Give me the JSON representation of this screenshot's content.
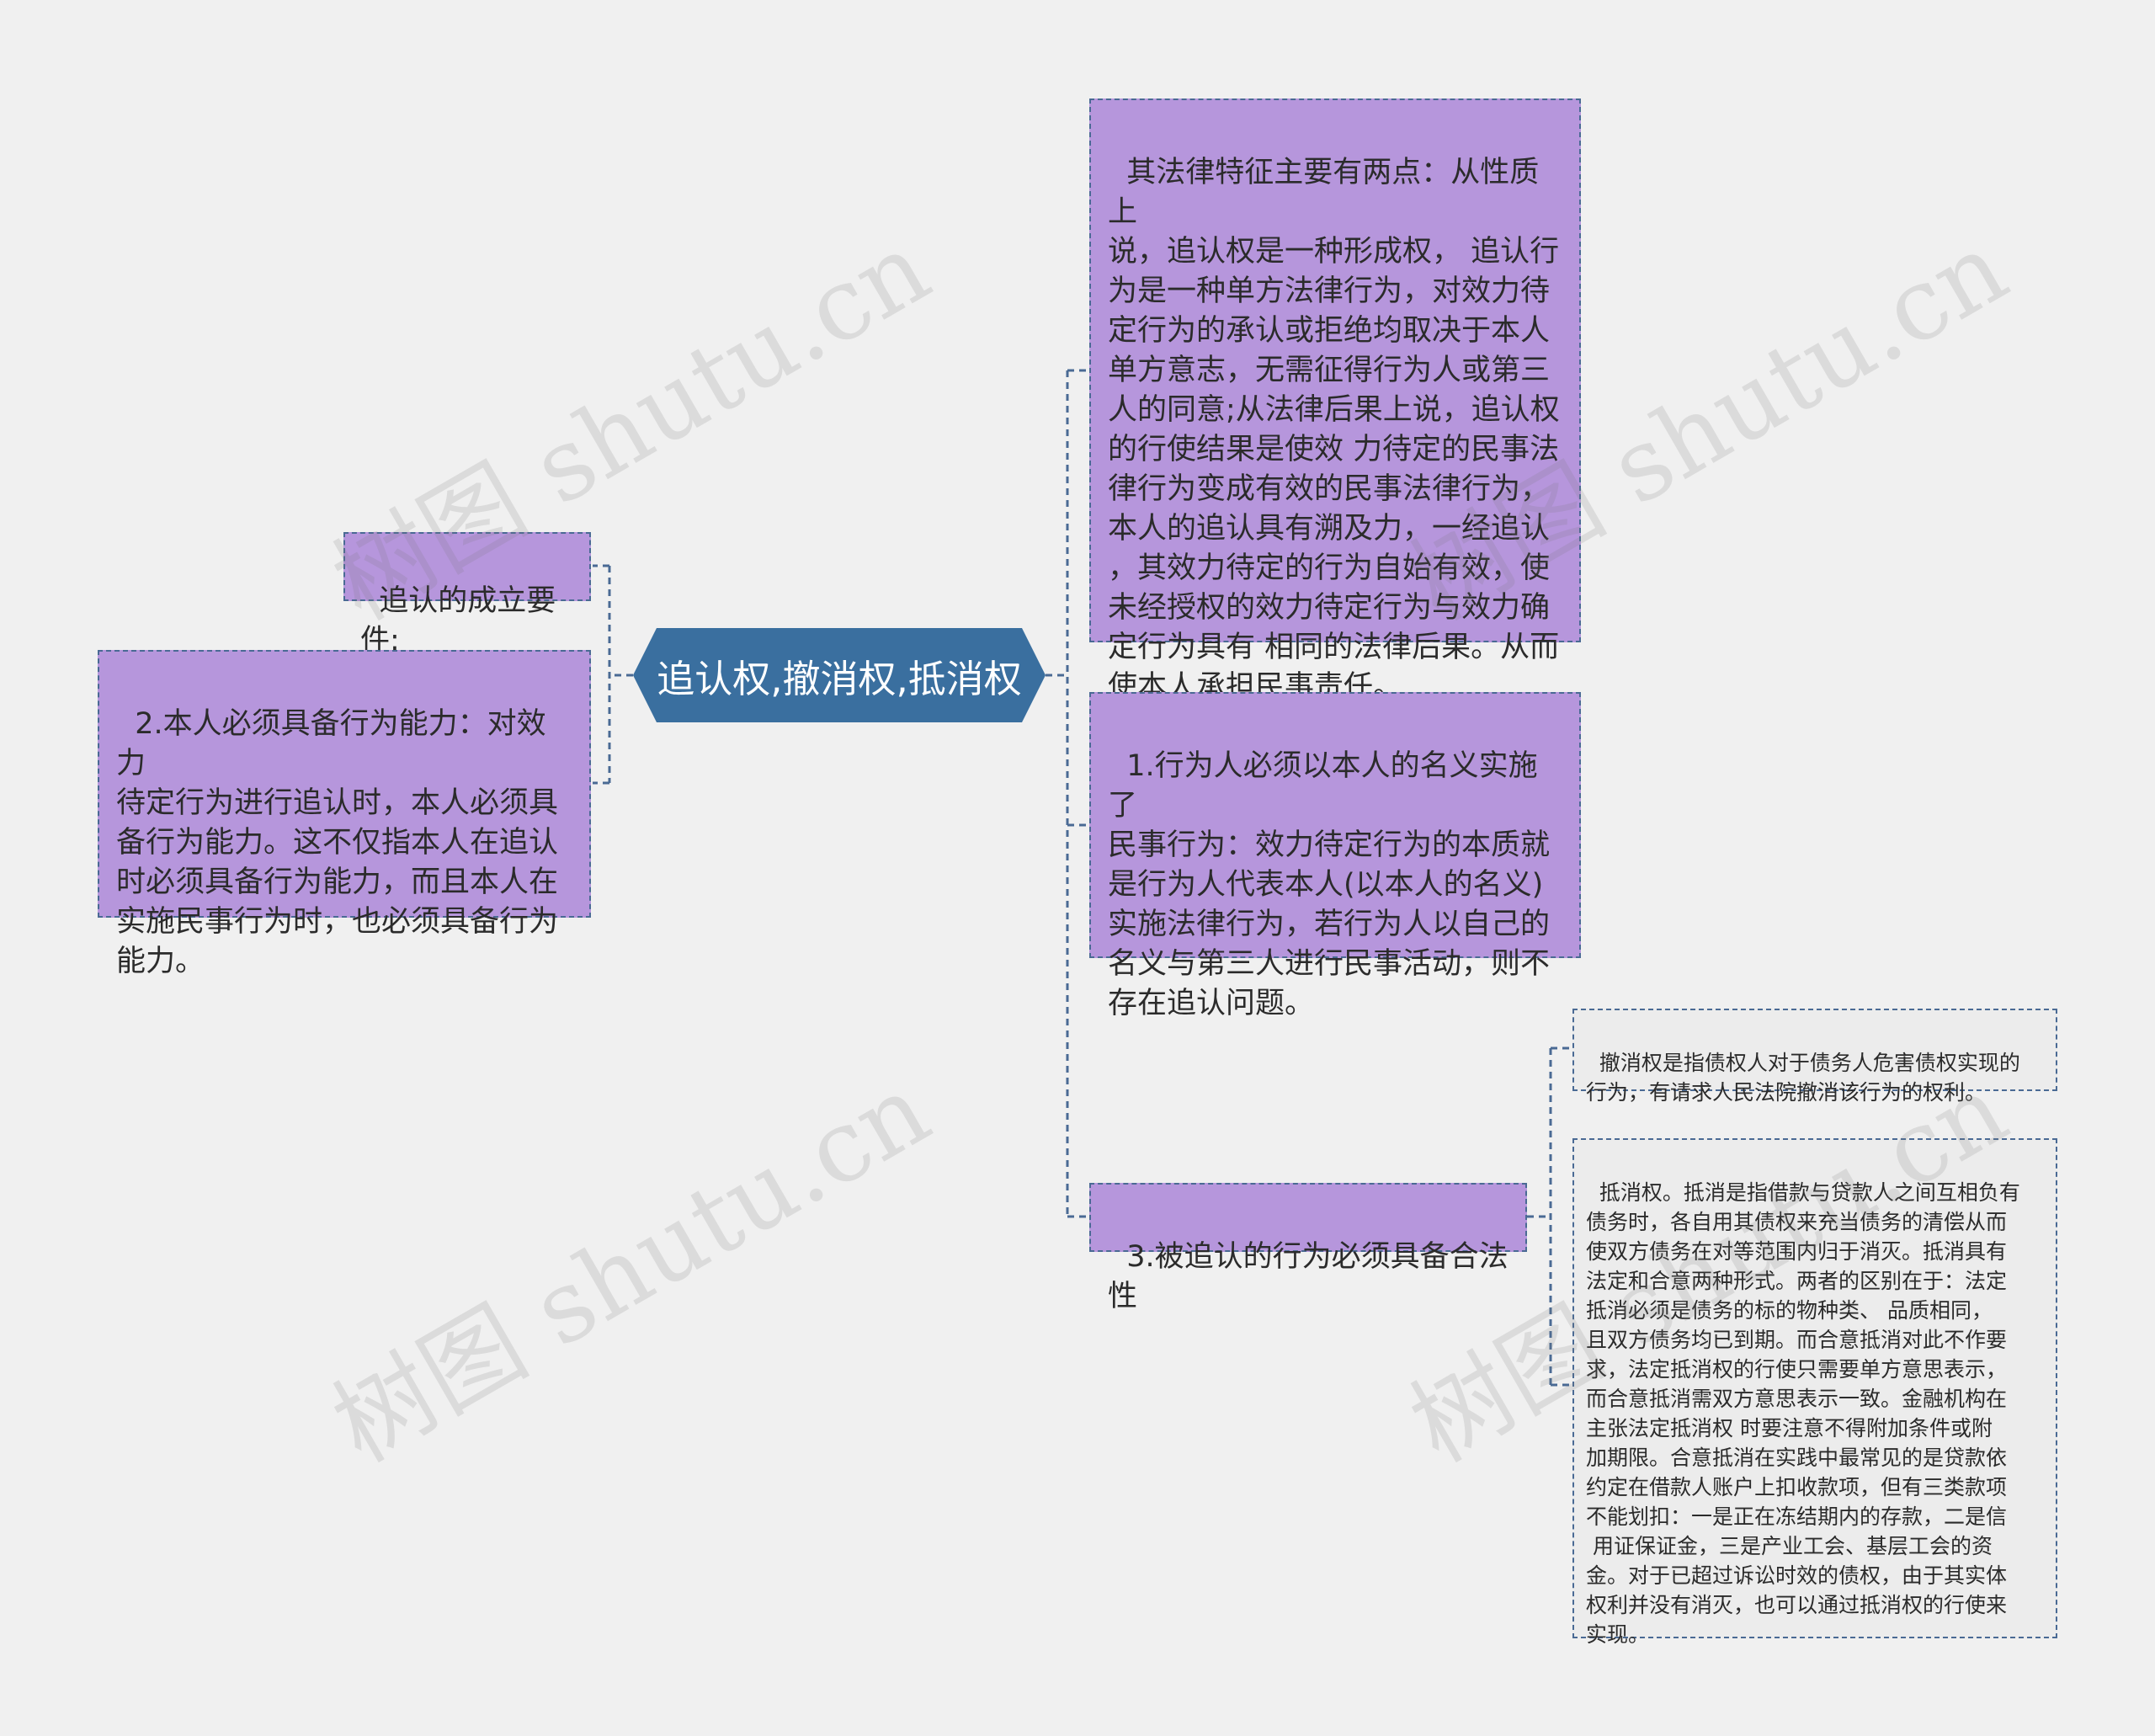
{
  "root": {
    "label": "追认权,撤消权,抵消权"
  },
  "left_branches": [
    {
      "text": "追认的成立要件:"
    },
    {
      "text": "2.本人必须具备行为能力：对效力\n待定行为进行追认时，本人必须具\n备行为能力。这不仅指本人在追认\n时必须具备行为能力，而且本人在\n实施民事行为时，也必须具备行为\n能力。"
    }
  ],
  "right_branches": [
    {
      "text": "其法律特征主要有两点：从性质上\n说，追认权是一种形成权， 追认行\n为是一种单方法律行为，对效力待\n定行为的承认或拒绝均取决于本人\n单方意志，无需征得行为人或第三\n人的同意;从法律后果上说，追认权\n的行使结果是使效 力待定的民事法\n律行为变成有效的民事法律行为，\n本人的追认具有溯及力，一经追认\n，其效力待定的行为自始有效，使\n未经授权的效力待定行为与效力确\n定行为具有 相同的法律后果。从而\n使本人承担民事责任。"
    },
    {
      "text": "1.行为人必须以本人的名义实施了\n民事行为：效力待定行为的本质就\n是行为人代表本人(以本人的名义)\n实施法律行为，若行为人以自己的\n名义与第三人进行民事活动，则不\n存在追认问题。"
    },
    {
      "text": "3.被追认的行为必须具备合法性",
      "children": [
        {
          "text": "撤消权是指债权人对于债务人危害债权实现的\n行为，有请求人民法院撤消该行为的权利。"
        },
        {
          "text": "抵消权。抵消是指借款与贷款人之间互相负有\n债务时，各自用其债权来充当债务的清偿从而\n使双方债务在对等范围内归于消灭。抵消具有\n法定和合意两种形式。两者的区别在于：法定\n抵消必须是债务的标的物种类、 品质相同，\n且双方债务均已到期。而合意抵消对此不作要\n求，法定抵消权的行使只需要单方意思表示，\n而合意抵消需双方意思表示一致。金融机构在\n主张法定抵消权 时要注意不得附加条件或附\n加期限。合意抵消在实践中最常见的是贷款依\n约定在借款人账户上扣收款项，但有三类款项\n不能划扣：一是正在冻结期内的存款，二是信\n 用证保证金，三是产业工会、基层工会的资\n金。对于已超过诉讼时效的债权，由于其实体\n权利并没有消灭，也可以通过抵消权的行使来\n实现。"
        }
      ]
    }
  ],
  "watermark": {
    "text": "树图 shutu.cn"
  },
  "colors": {
    "background": "#f0f0f0",
    "root_fill": "#3a6f9f",
    "node_fill": "#b696dc",
    "leaf_fill": "#ececec",
    "border": "#4a6a94",
    "connector": "#4a6a94"
  }
}
